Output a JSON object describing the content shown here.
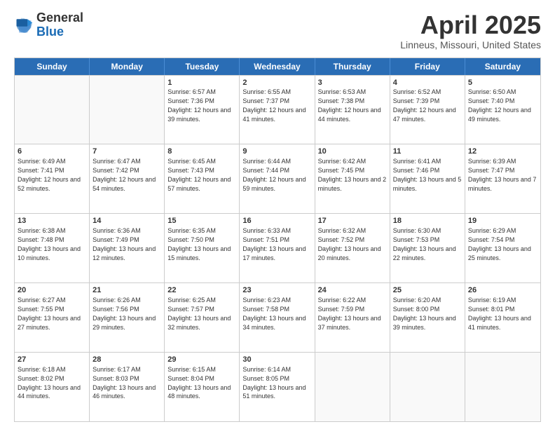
{
  "header": {
    "logo_general": "General",
    "logo_blue": "Blue",
    "title": "April 2025",
    "location": "Linneus, Missouri, United States"
  },
  "weekdays": [
    "Sunday",
    "Monday",
    "Tuesday",
    "Wednesday",
    "Thursday",
    "Friday",
    "Saturday"
  ],
  "weeks": [
    [
      {
        "day": "",
        "sunrise": "",
        "sunset": "",
        "daylight": "",
        "empty": true
      },
      {
        "day": "",
        "sunrise": "",
        "sunset": "",
        "daylight": "",
        "empty": true
      },
      {
        "day": "1",
        "sunrise": "Sunrise: 6:57 AM",
        "sunset": "Sunset: 7:36 PM",
        "daylight": "Daylight: 12 hours and 39 minutes."
      },
      {
        "day": "2",
        "sunrise": "Sunrise: 6:55 AM",
        "sunset": "Sunset: 7:37 PM",
        "daylight": "Daylight: 12 hours and 41 minutes."
      },
      {
        "day": "3",
        "sunrise": "Sunrise: 6:53 AM",
        "sunset": "Sunset: 7:38 PM",
        "daylight": "Daylight: 12 hours and 44 minutes."
      },
      {
        "day": "4",
        "sunrise": "Sunrise: 6:52 AM",
        "sunset": "Sunset: 7:39 PM",
        "daylight": "Daylight: 12 hours and 47 minutes."
      },
      {
        "day": "5",
        "sunrise": "Sunrise: 6:50 AM",
        "sunset": "Sunset: 7:40 PM",
        "daylight": "Daylight: 12 hours and 49 minutes."
      }
    ],
    [
      {
        "day": "6",
        "sunrise": "Sunrise: 6:49 AM",
        "sunset": "Sunset: 7:41 PM",
        "daylight": "Daylight: 12 hours and 52 minutes."
      },
      {
        "day": "7",
        "sunrise": "Sunrise: 6:47 AM",
        "sunset": "Sunset: 7:42 PM",
        "daylight": "Daylight: 12 hours and 54 minutes."
      },
      {
        "day": "8",
        "sunrise": "Sunrise: 6:45 AM",
        "sunset": "Sunset: 7:43 PM",
        "daylight": "Daylight: 12 hours and 57 minutes."
      },
      {
        "day": "9",
        "sunrise": "Sunrise: 6:44 AM",
        "sunset": "Sunset: 7:44 PM",
        "daylight": "Daylight: 12 hours and 59 minutes."
      },
      {
        "day": "10",
        "sunrise": "Sunrise: 6:42 AM",
        "sunset": "Sunset: 7:45 PM",
        "daylight": "Daylight: 13 hours and 2 minutes."
      },
      {
        "day": "11",
        "sunrise": "Sunrise: 6:41 AM",
        "sunset": "Sunset: 7:46 PM",
        "daylight": "Daylight: 13 hours and 5 minutes."
      },
      {
        "day": "12",
        "sunrise": "Sunrise: 6:39 AM",
        "sunset": "Sunset: 7:47 PM",
        "daylight": "Daylight: 13 hours and 7 minutes."
      }
    ],
    [
      {
        "day": "13",
        "sunrise": "Sunrise: 6:38 AM",
        "sunset": "Sunset: 7:48 PM",
        "daylight": "Daylight: 13 hours and 10 minutes."
      },
      {
        "day": "14",
        "sunrise": "Sunrise: 6:36 AM",
        "sunset": "Sunset: 7:49 PM",
        "daylight": "Daylight: 13 hours and 12 minutes."
      },
      {
        "day": "15",
        "sunrise": "Sunrise: 6:35 AM",
        "sunset": "Sunset: 7:50 PM",
        "daylight": "Daylight: 13 hours and 15 minutes."
      },
      {
        "day": "16",
        "sunrise": "Sunrise: 6:33 AM",
        "sunset": "Sunset: 7:51 PM",
        "daylight": "Daylight: 13 hours and 17 minutes."
      },
      {
        "day": "17",
        "sunrise": "Sunrise: 6:32 AM",
        "sunset": "Sunset: 7:52 PM",
        "daylight": "Daylight: 13 hours and 20 minutes."
      },
      {
        "day": "18",
        "sunrise": "Sunrise: 6:30 AM",
        "sunset": "Sunset: 7:53 PM",
        "daylight": "Daylight: 13 hours and 22 minutes."
      },
      {
        "day": "19",
        "sunrise": "Sunrise: 6:29 AM",
        "sunset": "Sunset: 7:54 PM",
        "daylight": "Daylight: 13 hours and 25 minutes."
      }
    ],
    [
      {
        "day": "20",
        "sunrise": "Sunrise: 6:27 AM",
        "sunset": "Sunset: 7:55 PM",
        "daylight": "Daylight: 13 hours and 27 minutes."
      },
      {
        "day": "21",
        "sunrise": "Sunrise: 6:26 AM",
        "sunset": "Sunset: 7:56 PM",
        "daylight": "Daylight: 13 hours and 29 minutes."
      },
      {
        "day": "22",
        "sunrise": "Sunrise: 6:25 AM",
        "sunset": "Sunset: 7:57 PM",
        "daylight": "Daylight: 13 hours and 32 minutes."
      },
      {
        "day": "23",
        "sunrise": "Sunrise: 6:23 AM",
        "sunset": "Sunset: 7:58 PM",
        "daylight": "Daylight: 13 hours and 34 minutes."
      },
      {
        "day": "24",
        "sunrise": "Sunrise: 6:22 AM",
        "sunset": "Sunset: 7:59 PM",
        "daylight": "Daylight: 13 hours and 37 minutes."
      },
      {
        "day": "25",
        "sunrise": "Sunrise: 6:20 AM",
        "sunset": "Sunset: 8:00 PM",
        "daylight": "Daylight: 13 hours and 39 minutes."
      },
      {
        "day": "26",
        "sunrise": "Sunrise: 6:19 AM",
        "sunset": "Sunset: 8:01 PM",
        "daylight": "Daylight: 13 hours and 41 minutes."
      }
    ],
    [
      {
        "day": "27",
        "sunrise": "Sunrise: 6:18 AM",
        "sunset": "Sunset: 8:02 PM",
        "daylight": "Daylight: 13 hours and 44 minutes."
      },
      {
        "day": "28",
        "sunrise": "Sunrise: 6:17 AM",
        "sunset": "Sunset: 8:03 PM",
        "daylight": "Daylight: 13 hours and 46 minutes."
      },
      {
        "day": "29",
        "sunrise": "Sunrise: 6:15 AM",
        "sunset": "Sunset: 8:04 PM",
        "daylight": "Daylight: 13 hours and 48 minutes."
      },
      {
        "day": "30",
        "sunrise": "Sunrise: 6:14 AM",
        "sunset": "Sunset: 8:05 PM",
        "daylight": "Daylight: 13 hours and 51 minutes."
      },
      {
        "day": "",
        "sunrise": "",
        "sunset": "",
        "daylight": "",
        "empty": true
      },
      {
        "day": "",
        "sunrise": "",
        "sunset": "",
        "daylight": "",
        "empty": true
      },
      {
        "day": "",
        "sunrise": "",
        "sunset": "",
        "daylight": "",
        "empty": true
      }
    ]
  ]
}
